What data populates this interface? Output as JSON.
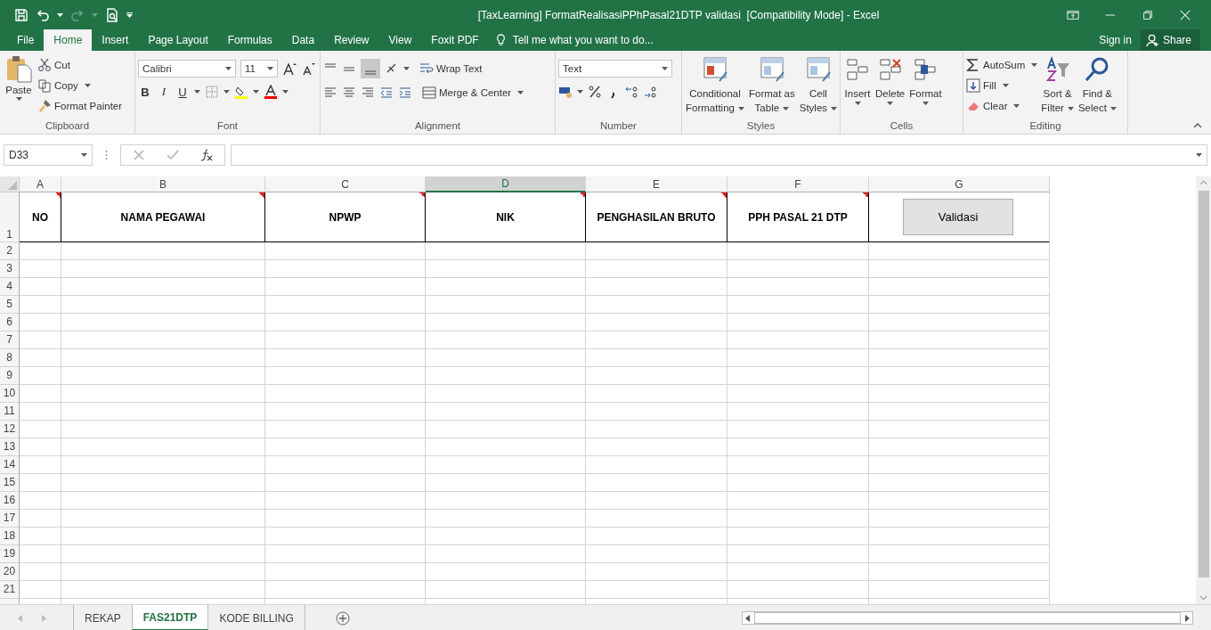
{
  "title_bar": {
    "title": "[TaxLearning] FormatRealisasiPPhPasal21DTP validasi  [Compatibility Mode] - Excel"
  },
  "menu_tabs": [
    {
      "label": "File",
      "selected": false
    },
    {
      "label": "Home",
      "selected": true
    },
    {
      "label": "Insert",
      "selected": false
    },
    {
      "label": "Page Layout",
      "selected": false
    },
    {
      "label": "Formulas",
      "selected": false
    },
    {
      "label": "Data",
      "selected": false
    },
    {
      "label": "Review",
      "selected": false
    },
    {
      "label": "View",
      "selected": false
    },
    {
      "label": "Foxit PDF",
      "selected": false
    }
  ],
  "tell_me": {
    "placeholder": "Tell me what you want to do..."
  },
  "sign_in": "Sign in",
  "share": "Share",
  "ribbon": {
    "clipboard": {
      "paste": "Paste",
      "cut": "Cut",
      "copy": "Copy",
      "format_painter": "Format Painter",
      "label": "Clipboard"
    },
    "font": {
      "name": "Calibri",
      "size": "11",
      "bold": "B",
      "italic": "I",
      "underline": "U",
      "label": "Font"
    },
    "alignment": {
      "wrap_text": "Wrap Text",
      "merge": "Merge & Center",
      "label": "Alignment"
    },
    "number": {
      "format": "Text",
      "label": "Number"
    },
    "styles": {
      "buttons": [
        {
          "lines": [
            "Conditional",
            "Formatting"
          ]
        },
        {
          "lines": [
            "Format as",
            "Table"
          ]
        },
        {
          "lines": [
            "Cell",
            "Styles"
          ]
        }
      ],
      "label": "Styles"
    },
    "cells": {
      "buttons": [
        "Insert",
        "Delete",
        "Format"
      ],
      "label": "Cells"
    },
    "editing": {
      "autosum": "AutoSum",
      "fill": "Fill",
      "clear": "Clear",
      "sort": [
        "Sort &",
        "Filter"
      ],
      "find": [
        "Find &",
        "Select"
      ],
      "label": "Editing"
    }
  },
  "formula_bar": {
    "name_box": "D33"
  },
  "sheet": {
    "columns": [
      {
        "letter": "A",
        "selected": false
      },
      {
        "letter": "B",
        "selected": false
      },
      {
        "letter": "C",
        "selected": false
      },
      {
        "letter": "D",
        "selected": true
      },
      {
        "letter": "E",
        "selected": false
      },
      {
        "letter": "F",
        "selected": false
      },
      {
        "letter": "G",
        "selected": false
      }
    ],
    "header_row": {
      "number": "1",
      "cells": [
        {
          "text": "NO",
          "comment": true
        },
        {
          "text": "NAMA PEGAWAI",
          "comment": true
        },
        {
          "text": "NPWP",
          "comment": true
        },
        {
          "text": "NIK",
          "comment": true
        },
        {
          "text": "PENGHASILAN BRUTO",
          "comment": true
        },
        {
          "text": "PPH PASAL 21 DTP",
          "comment": true
        }
      ],
      "button": "Validasi"
    },
    "rows": [
      "2",
      "3",
      "4",
      "5",
      "6",
      "7",
      "8",
      "9",
      "10",
      "11",
      "12",
      "13",
      "14",
      "15",
      "16",
      "17",
      "18",
      "19",
      "20",
      "21"
    ]
  },
  "sheet_tabs": [
    {
      "label": "REKAP",
      "selected": false
    },
    {
      "label": "FAS21DTP",
      "selected": true
    },
    {
      "label": "KODE BILLING",
      "selected": false
    }
  ]
}
